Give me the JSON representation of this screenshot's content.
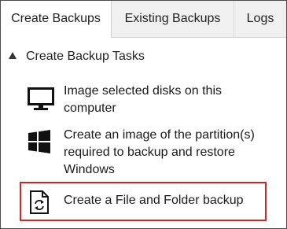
{
  "tabs": [
    {
      "label": "Create Backups",
      "active": true
    },
    {
      "label": "Existing Backups",
      "active": false
    },
    {
      "label": "Logs",
      "active": false
    }
  ],
  "section": {
    "title": "Create Backup Tasks"
  },
  "tasks": [
    {
      "label": "Image selected disks on this computer",
      "icon": "monitor-icon"
    },
    {
      "label": "Create an image of the partition(s) required to backup and restore Windows",
      "icon": "windows-logo-icon"
    },
    {
      "label": "Create a File and Folder backup",
      "icon": "file-sync-icon",
      "highlighted": true
    }
  ],
  "colors": {
    "highlight_border": "#e02020",
    "tabbar_bg": "#f0f0f0"
  }
}
